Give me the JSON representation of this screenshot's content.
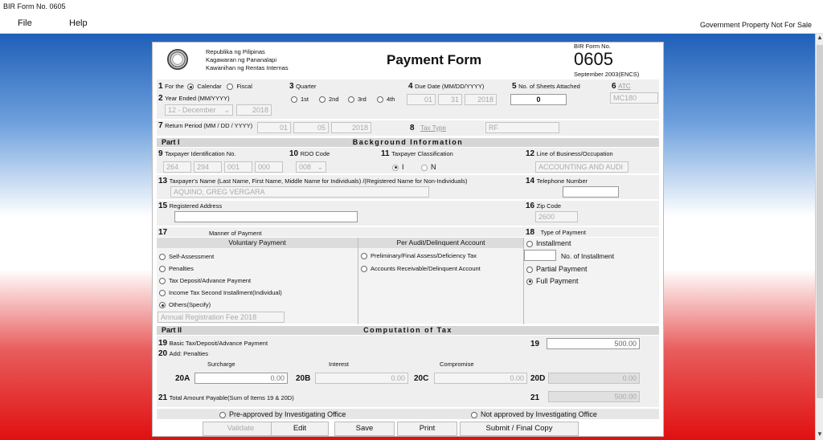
{
  "window": {
    "title": "BIR Form No. 0605",
    "disclaimer": "Government Property Not For Sale"
  },
  "menu": {
    "file": "File",
    "help": "Help"
  },
  "header": {
    "agency_line1": "Republika ng Pilipinas",
    "agency_line2": "Kagawaran ng Pananalapi",
    "agency_line3": "Kawanihan ng Rentas Internas",
    "form_title": "Payment Form",
    "form_no_label": "BIR Form No.",
    "form_no": "0605",
    "form_edition": "September 2003(ENCS)"
  },
  "items": {
    "i1": {
      "num": "1",
      "label": "For the",
      "calendar": "Calendar",
      "fiscal": "Fiscal"
    },
    "i2": {
      "num": "2",
      "label": "Year Ended (MM/YYYY)",
      "month": "12 - December",
      "year": "2018"
    },
    "i3": {
      "num": "3",
      "label": "Quarter",
      "q1": "1st",
      "q2": "2nd",
      "q3": "3rd",
      "q4": "4th"
    },
    "i4": {
      "num": "4",
      "label": "Due Date (MM/DD/YYYY)",
      "mm": "01",
      "dd": "31",
      "yyyy": "2018"
    },
    "i5": {
      "num": "5",
      "label": "No. of Sheets Attached",
      "value": "0"
    },
    "i6": {
      "num": "6",
      "label": "ATC",
      "value": "MC180"
    },
    "i7": {
      "num": "7",
      "label": "Return Period (MM / DD / YYYY)",
      "mm": "01",
      "dd": "05",
      "yyyy": "2018"
    },
    "i8": {
      "num": "8",
      "label": "Tax Type",
      "value": "RF"
    },
    "i9": {
      "num": "9",
      "label": "Taxpayer Identification No.",
      "t1": "264",
      "t2": "294",
      "t3": "001",
      "t4": "000"
    },
    "i10": {
      "num": "10",
      "label": "RDO Code",
      "value": "008"
    },
    "i11": {
      "num": "11",
      "label": "Taxpayer Classification",
      "opt_i": "I",
      "opt_n": "N"
    },
    "i12": {
      "num": "12",
      "label": "Line of Business/Occupation",
      "value": "ACCOUNTING AND AUDI"
    },
    "i13": {
      "num": "13",
      "label": "Taxpayer's Name (Last Name, First Name, Middle Name for Individuals) /(Registered Name for Non-Individuals)",
      "value": "AQUINO, GREG VERGARA"
    },
    "i14": {
      "num": "14",
      "label": "Telephone Number",
      "value": ""
    },
    "i15": {
      "num": "15",
      "label": "Registered Address",
      "value": ""
    },
    "i16": {
      "num": "16",
      "label": "Zip Code",
      "value": "2600"
    },
    "i17": {
      "num": "17",
      "label": "Manner of Payment"
    },
    "i18": {
      "num": "18",
      "label": "Type of Payment"
    }
  },
  "part1": {
    "part": "Part I",
    "title": "Background Information"
  },
  "part2": {
    "part": "Part II",
    "title": "Computation of Tax"
  },
  "manner": {
    "voluntary_header": "Voluntary Payment",
    "audit_header": "Per Audit/Delinquent Account",
    "self_assessment": "Self-Assessment",
    "penalties": "Penalties",
    "tax_deposit": "Tax Deposit/Advance Payment",
    "income_tax_second": "Income Tax Second Installment(Individual)",
    "others": "Others(Specify)",
    "others_value": "Annual Registration Fee 2018",
    "preliminary": "Preliminary/Final Assess/Deficiency Tax",
    "accounts_receivable": "Accounts Receivable/Delinquent Account"
  },
  "type_payment": {
    "installment": "Installment",
    "no_installment": "No. of Installment",
    "partial": "Partial Payment",
    "full": "Full Payment"
  },
  "computation": {
    "i19_num": "19",
    "i19_label": "Basic Tax/Deposit/Advance Payment",
    "i19_value": "500.00",
    "i20_num": "20",
    "i20_label": "Add: Penalties",
    "surcharge": "Surcharge",
    "interest": "Interest",
    "compromise": "Compromise",
    "a20": "20A",
    "a20_value": "0.00",
    "b20": "20B",
    "b20_value": "0.00",
    "c20": "20C",
    "c20_value": "0.00",
    "d20": "20D",
    "d20_value": "0.00",
    "i21_num": "21",
    "i21_label": "Total Amount Payable(Sum of Items 19 & 20D)",
    "i21_value": "500.00"
  },
  "approval": {
    "pre_approved": "Pre-approved by Investigating Office",
    "not_approved": "Not approved by Investigating Office"
  },
  "buttons": {
    "validate": "Validate",
    "edit": "Edit",
    "save": "Save",
    "print": "Print",
    "submit": "Submit / Final Copy"
  }
}
